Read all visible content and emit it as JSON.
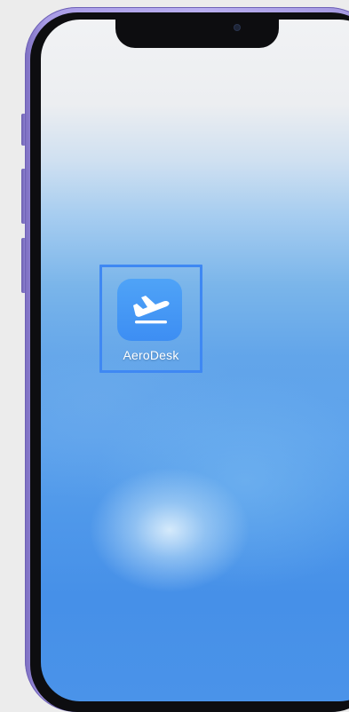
{
  "home_screen": {
    "apps": [
      {
        "label": "AeroDesk",
        "icon": "airplane-takeoff-icon"
      }
    ]
  },
  "colors": {
    "frame": "#a99ce6",
    "bezel": "#0d0d10",
    "app_icon_bg": "#3d8ef3",
    "highlight": "#3f88f3"
  }
}
